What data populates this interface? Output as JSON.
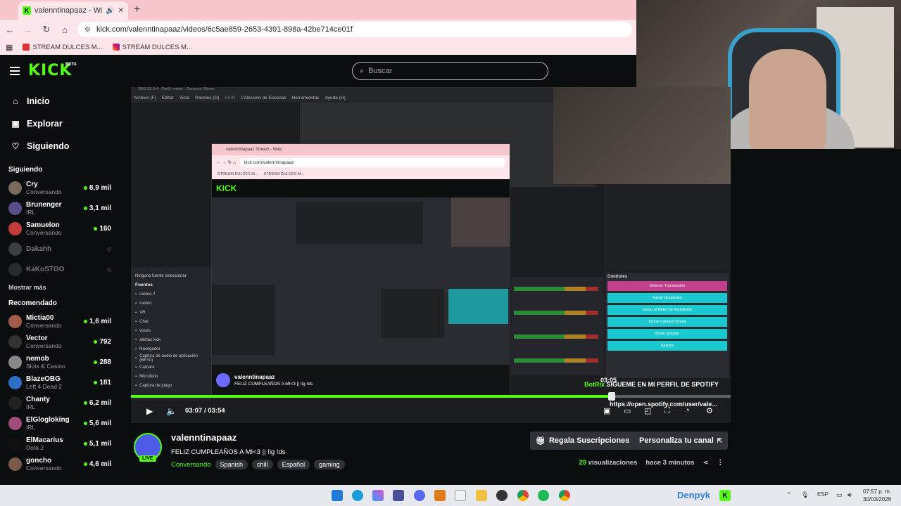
{
  "browser": {
    "tab_title": "valenntinapaaz - Watch the",
    "url": "kick.com/valenntinapaaz/videos/6c5ae859-2653-4391-898a-42be714ce01f",
    "bookmarks": [
      "STREAM DULCES M...",
      "STREAM DULCES M..."
    ]
  },
  "header": {
    "logo": "KICK",
    "logo_badge": "BETA",
    "search_placeholder": "Buscar"
  },
  "sidebar": {
    "nav": [
      {
        "label": "Inicio",
        "icon": "home-icon"
      },
      {
        "label": "Explorar",
        "icon": "compass-icon"
      },
      {
        "label": "Siguiendo",
        "icon": "heart-icon"
      }
    ],
    "following_title": "Siguiendo",
    "following": [
      {
        "name": "Cry",
        "category": "Conversando",
        "viewers": "8,9 mil",
        "live": true,
        "color": "#7c6a5e"
      },
      {
        "name": "Brunenger",
        "category": "IRL",
        "viewers": "3,1 mil",
        "live": true,
        "color": "#5a4d8a"
      },
      {
        "name": "Samuelon",
        "category": "Conversando",
        "viewers": "160",
        "live": true,
        "color": "#c43c3c"
      },
      {
        "name": "Dakahh",
        "category": "",
        "viewers": "",
        "live": false,
        "color": "#888"
      },
      {
        "name": "KaKoSTGO",
        "category": "",
        "viewers": "",
        "live": false,
        "color": "#555"
      }
    ],
    "show_more": "Mostrar más",
    "recommended_title": "Recomendado",
    "recommended": [
      {
        "name": "Mictia00",
        "category": "Conversando",
        "viewers": "1,6 mil",
        "color": "#a35a4a"
      },
      {
        "name": "Vector",
        "category": "Conversando",
        "viewers": "792",
        "color": "#333"
      },
      {
        "name": "nemob",
        "category": "Slots & Casino",
        "viewers": "288",
        "color": "#888"
      },
      {
        "name": "BlazeOBG",
        "category": "Left 4 Dead 2",
        "viewers": "181",
        "color": "#2b6fc4"
      },
      {
        "name": "Chanty",
        "category": "IRL",
        "viewers": "6,2 mil",
        "color": "#222"
      },
      {
        "name": "ElGlogloking",
        "category": "IRL",
        "viewers": "5,6 mil",
        "color": "#a24a7a"
      },
      {
        "name": "ElMacarius",
        "category": "Dota 2",
        "viewers": "5,1 mil",
        "color": "#111"
      },
      {
        "name": "goncho",
        "category": "Conversando",
        "viewers": "4,6 mil",
        "color": "#7a5a4a"
      }
    ]
  },
  "video": {
    "obs_menu": [
      "Archivo (F)",
      "Editar",
      "Vista",
      "Paneles (D)",
      "Perfil",
      "Colección de Escenas",
      "Herramientas",
      "Ayuda (H)"
    ],
    "obs_title": "OBS 32.0.4 - Perfil: meme - Escenas: Meme",
    "inner_url": "kick.com/valenntinapaaz",
    "inner_tab": "valenntinapaaz Stream - Watc",
    "inner_bookmarks": [
      "STREAM DULCES M...",
      "STREAM DULCES M..."
    ],
    "inner_logo": "KICK",
    "inner_chat_name": "valenntinapaaz",
    "inner_chat_title": "FELIZ CUMPLEAÑOS A MI<3 || !ig !ds",
    "no_source": "Ninguna fuente seleccionar",
    "sources_title": "Fuentes",
    "sources": [
      "casino 2",
      "casino",
      "VR",
      "Chat",
      "voces",
      "alertas kick",
      "Navegador",
      "Captura de audio de aplicación (BETA)",
      "Camara",
      "Microfono",
      "Captura de juego"
    ],
    "controls_title": "Controles",
    "controls": [
      "Detener Transmisión",
      "Iniciar Grabación",
      "Iniciar el Búfer de Repetición",
      "Iniciar Cámara Virtual",
      "Modo Estudio",
      "Ajustes"
    ],
    "bot_name": "BotRix",
    "bot_msg": "SIGUEME EN MI PERFIL DE SPOTIFY",
    "bot_link": "https://open.spotify.com/user/vale...",
    "hover_time": "03:05",
    "current_time": "03:07",
    "duration": "03:54",
    "progress": 0.801
  },
  "info": {
    "channel": "valenntinapaaz",
    "live_badge": "LIVE",
    "title": "FELIZ CUMPLEAÑOS A MI<3 || !ig !ds",
    "category": "Conversando",
    "tags": [
      "Spanish",
      "chill",
      "Español",
      "gaming"
    ],
    "gift_button": "Regala Suscripciones",
    "customize_button": "Personaliza tu canal",
    "views_count": "29",
    "views_label": "visualizaciones",
    "ago": "hace 3 minutos"
  },
  "taskbar": {
    "brand": "Denpyk",
    "lang": "ESP",
    "time": "07:57 p. m.",
    "date": "30/03/2026"
  },
  "colors": {
    "kick_green": "#53fc18",
    "tab_pink": "#f7c6cc",
    "obs_cyan": "#19c9cf",
    "obs_stop": "#c0408c"
  }
}
